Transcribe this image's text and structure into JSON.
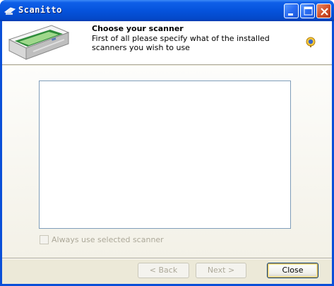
{
  "window": {
    "title": "Scanitto"
  },
  "header": {
    "title": "Choose your scanner",
    "description": "First of all please specify what of the installed scanners you wish to use"
  },
  "scanner_list": {
    "items": []
  },
  "options": {
    "always_use_label": "Always use selected scanner",
    "always_use_checked": false
  },
  "buttons": {
    "back": "< Back",
    "next": "Next >",
    "close": "Close"
  },
  "colors": {
    "titlebar": "#0553dc",
    "client": "#ece9d8",
    "list_border": "#7f9db9"
  }
}
